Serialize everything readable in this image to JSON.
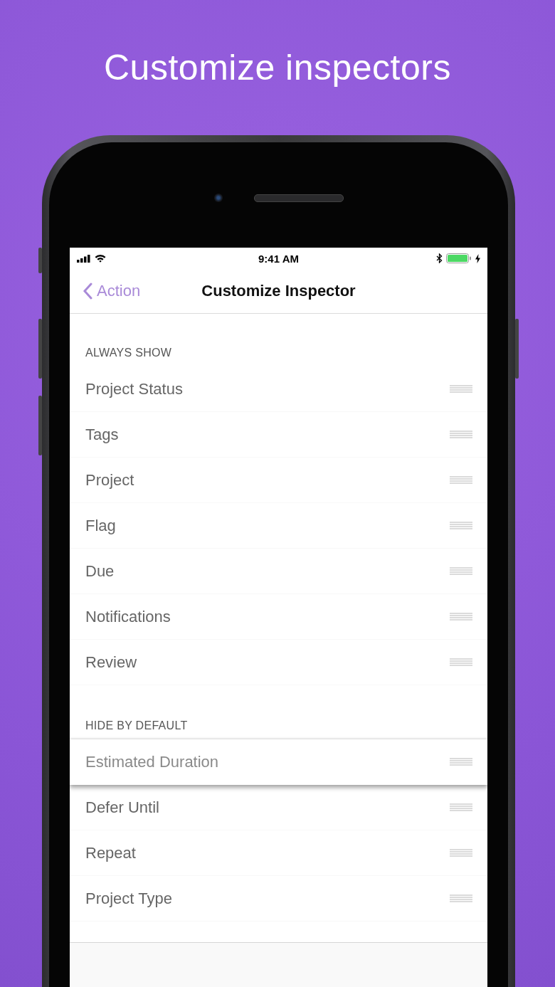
{
  "headline": "Customize inspectors",
  "status_bar": {
    "time": "9:41 AM"
  },
  "nav": {
    "back": "Action",
    "title": "Customize Inspector"
  },
  "sections": [
    {
      "header": "ALWAYS SHOW",
      "items": [
        {
          "label": "Project Status",
          "lifted": false
        },
        {
          "label": "Tags",
          "lifted": false
        },
        {
          "label": "Project",
          "lifted": false
        },
        {
          "label": "Flag",
          "lifted": false
        },
        {
          "label": "Due",
          "lifted": false
        },
        {
          "label": "Notifications",
          "lifted": false
        },
        {
          "label": "Review",
          "lifted": false
        }
      ]
    },
    {
      "header": "HIDE BY DEFAULT",
      "items": [
        {
          "label": "Estimated Duration",
          "lifted": true
        },
        {
          "label": "Defer Until",
          "lifted": false
        },
        {
          "label": "Repeat",
          "lifted": false
        },
        {
          "label": "Project Type",
          "lifted": false
        }
      ]
    }
  ]
}
